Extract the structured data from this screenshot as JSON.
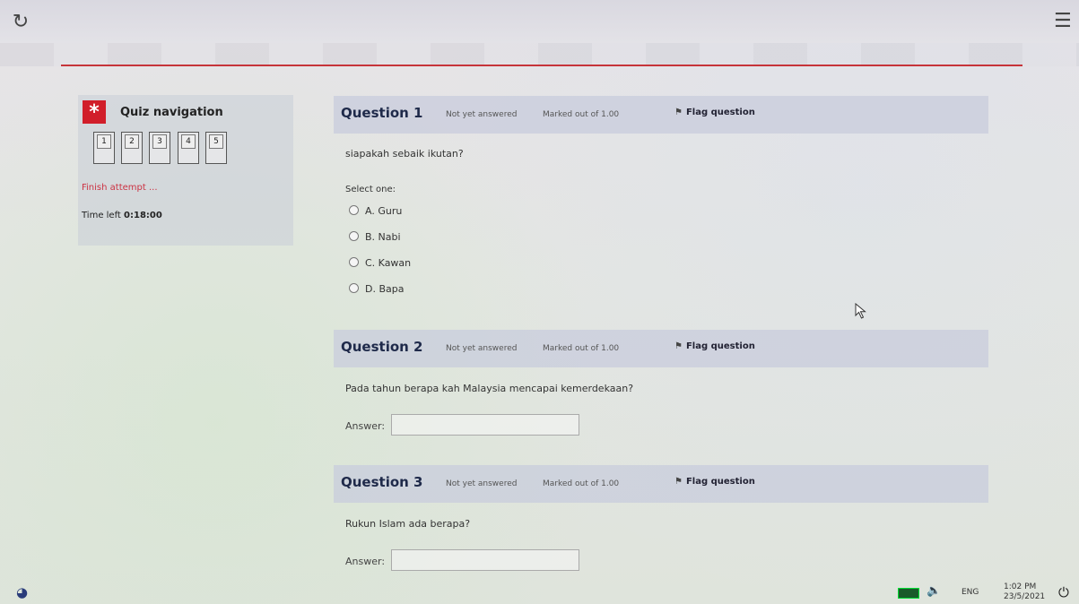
{
  "toolbar": {
    "reload_icon": "reload-icon",
    "menu_icon": "hamburger-menu-icon"
  },
  "nav": {
    "title": "Quiz navigation",
    "icon": "asterisk-icon",
    "question_numbers": [
      "1",
      "2",
      "3",
      "4",
      "5"
    ],
    "finish_label": "Finish attempt ...",
    "time_left_label": "Time left",
    "time_left_value": "0:18:00"
  },
  "questions": [
    {
      "title": "Question 1",
      "status": "Not yet answered",
      "marks": "Marked out of 1.00",
      "flag_label": "Flag question",
      "text": "siapakah sebaik ikutan?",
      "select_label": "Select one:",
      "options": [
        "A. Guru",
        "B. Nabi",
        "C. Kawan",
        "D. Bapa"
      ]
    },
    {
      "title": "Question 2",
      "status": "Not yet answered",
      "marks": "Marked out of 1.00",
      "flag_label": "Flag question",
      "text": "Pada tahun berapa kah Malaysia mencapai kemerdekaan?",
      "answer_label": "Answer:",
      "answer_value": ""
    },
    {
      "title": "Question 3",
      "status": "Not yet answered",
      "marks": "Marked out of 1.00",
      "flag_label": "Flag question",
      "text": "Rukun Islam ada berapa?",
      "answer_label": "Answer:",
      "answer_value": ""
    }
  ],
  "taskbar": {
    "language": "ENG",
    "time": "1:02 PM",
    "date": "23/5/2021"
  }
}
